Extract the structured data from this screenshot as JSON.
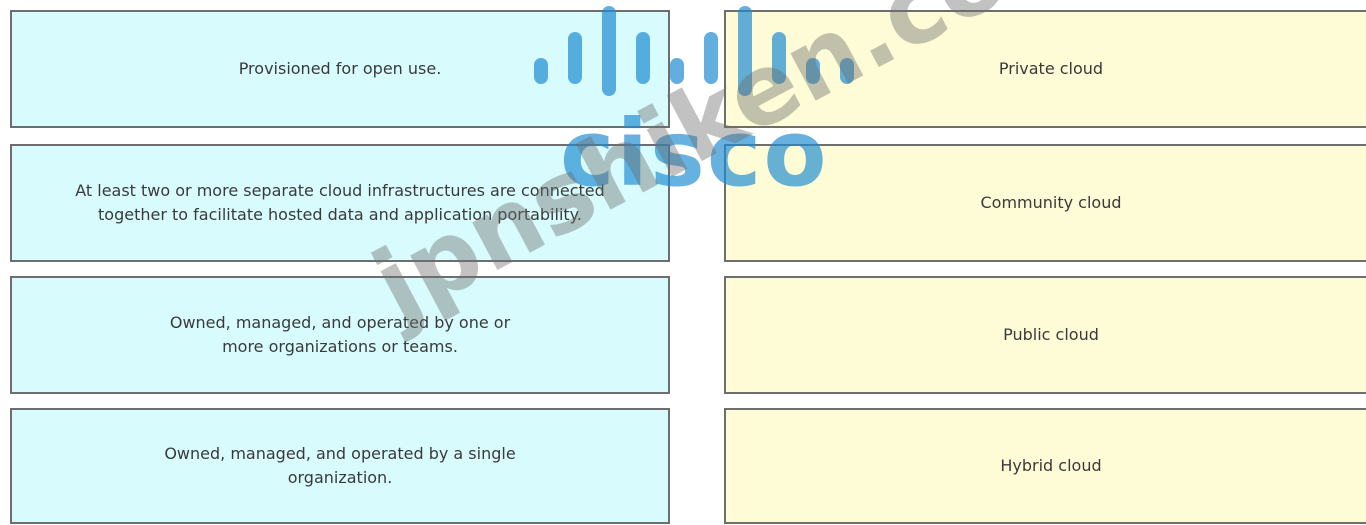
{
  "definitions": [
    {
      "text": "Provisioned for open use."
    },
    {
      "text": "At least two or more separate cloud infrastructures are connected\ntogether to facilitate hosted data and application portability."
    },
    {
      "text": "Owned, managed, and operated by one or\nmore organizations or teams."
    },
    {
      "text": "Owned, managed, and operated by a single\norganization."
    }
  ],
  "terms": [
    {
      "text": "Private cloud"
    },
    {
      "text": "Community cloud"
    },
    {
      "text": "Public cloud"
    },
    {
      "text": "Hybrid cloud"
    }
  ],
  "watermark": {
    "brand_text": "cisco",
    "site_text": "jpnshiken.com",
    "brand_color": "#1e8cd2",
    "site_color": "#6e6e6e"
  },
  "colors": {
    "definition_box": "#d8fbfe",
    "term_box": "#fdfcd6",
    "border": "#6e6e6e"
  }
}
